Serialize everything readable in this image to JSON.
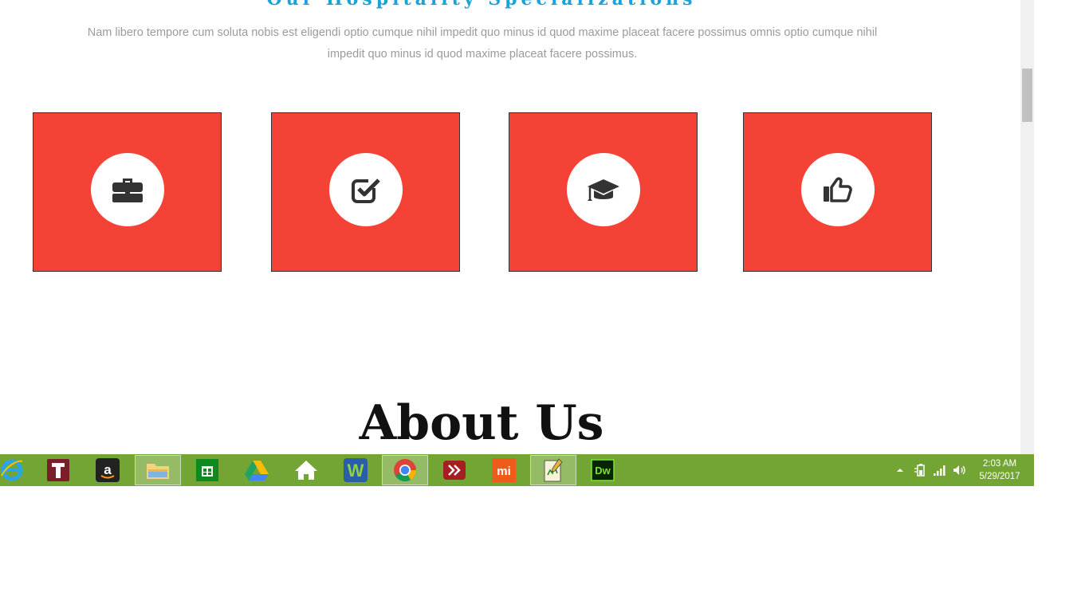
{
  "section": {
    "title": "Our Hospitality Specializations",
    "description": "Nam libero tempore cum soluta nobis est eligendi optio cumque nihil impedit quo minus id quod maxime placeat facere possimus omnis optio cumque nihil impedit quo minus id quod maxime placeat facere possimus."
  },
  "cards": [
    {
      "icon": "briefcase-icon"
    },
    {
      "icon": "check-square-icon"
    },
    {
      "icon": "graduation-cap-icon"
    },
    {
      "icon": "thumbs-up-icon"
    }
  ],
  "about": {
    "title": "About Us"
  },
  "colors": {
    "accent_red": "#f44336",
    "title_blue": "#1aa3d9",
    "taskbar_green": "#73a535"
  },
  "taskbar": {
    "apps": [
      {
        "icon": "internet-explorer-icon",
        "active": false
      },
      {
        "icon": "t-app-icon",
        "active": false
      },
      {
        "icon": "amazon-icon",
        "active": false
      },
      {
        "icon": "file-explorer-icon",
        "active": true
      },
      {
        "icon": "store-icon",
        "active": false
      },
      {
        "icon": "google-drive-icon",
        "active": false
      },
      {
        "icon": "home-icon",
        "active": false
      },
      {
        "icon": "w-app-icon",
        "active": false
      },
      {
        "icon": "chrome-icon",
        "active": true
      },
      {
        "icon": "forward-app-icon",
        "active": false
      },
      {
        "icon": "mi-icon",
        "active": false
      },
      {
        "icon": "notepad-icon",
        "active": true
      },
      {
        "icon": "dreamweaver-icon",
        "active": false
      }
    ],
    "dreamweaver_label": "Dw",
    "mi_label": "mi",
    "tray_icons": [
      "show-hidden-icon",
      "power-icon",
      "network-signal-icon",
      "volume-icon"
    ],
    "time": "2:03 AM",
    "date": "5/29/2017"
  }
}
